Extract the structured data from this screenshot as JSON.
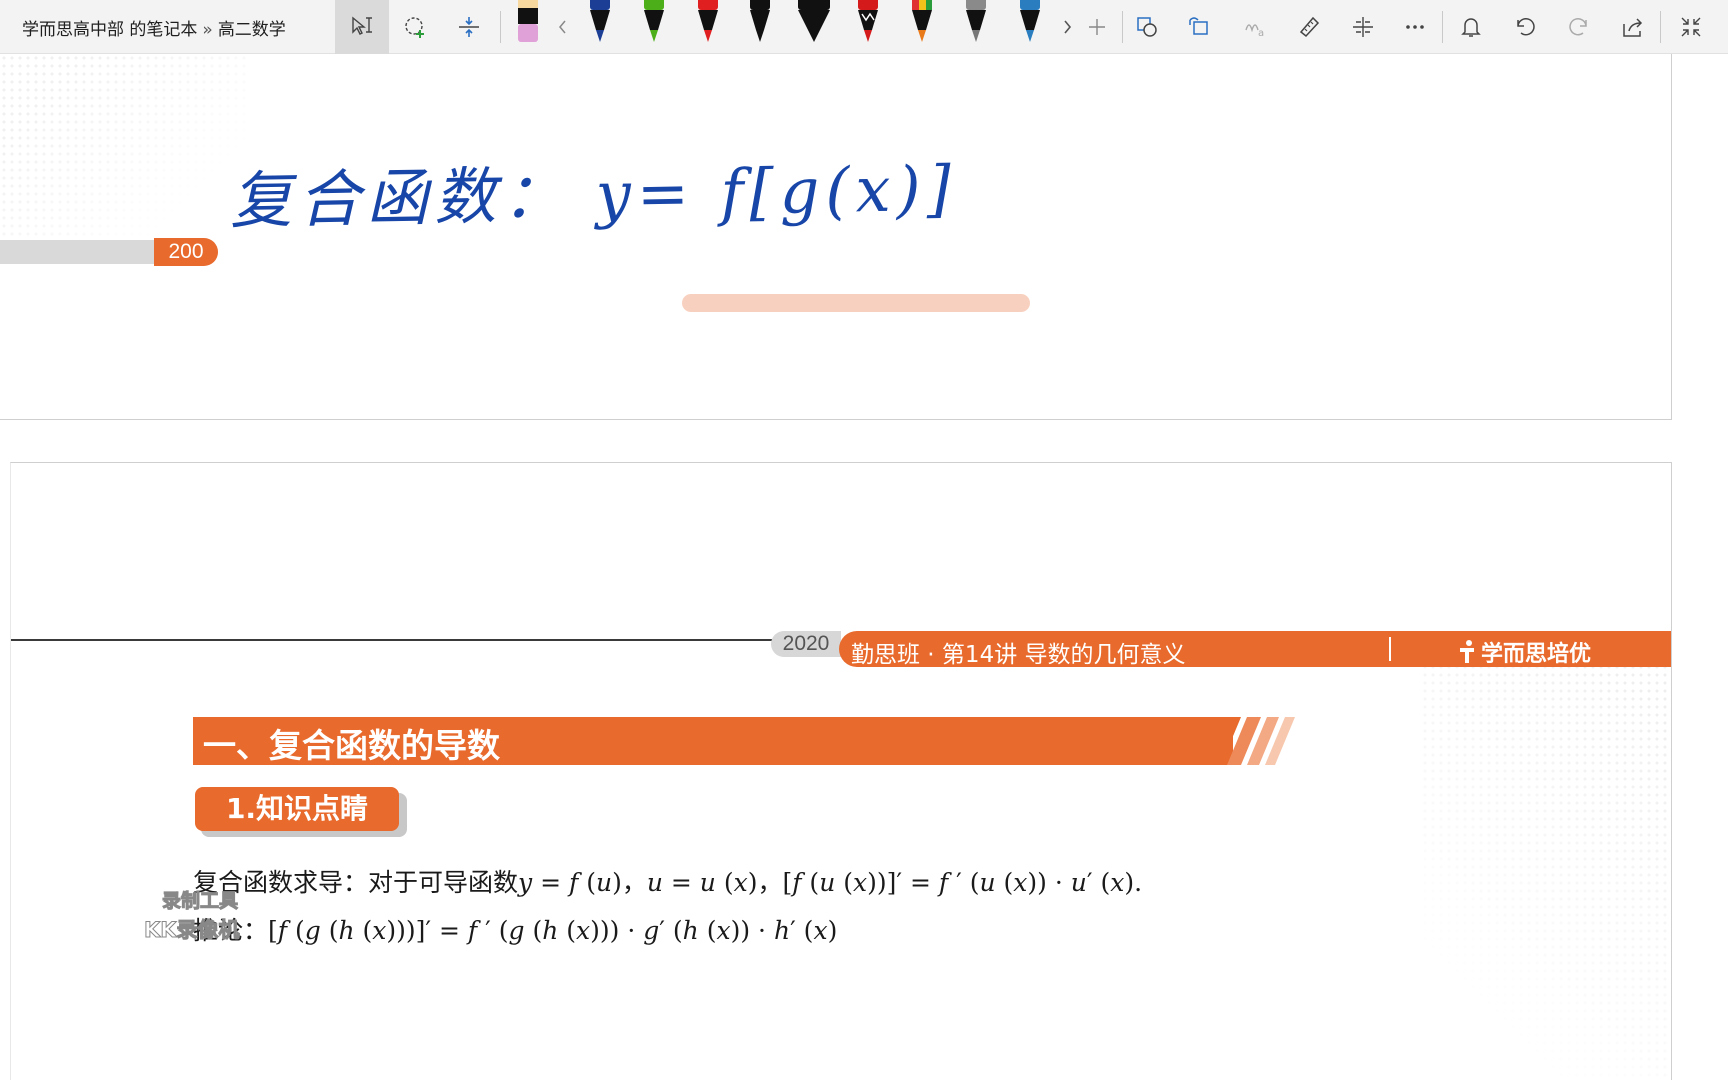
{
  "toolbar": {
    "breadcrumb_notebook": "学而思高中部 的笔记本",
    "breadcrumb_separator": "»",
    "breadcrumb_section": "高二数学",
    "tools": [
      {
        "name": "select-text-tool",
        "icon": "cursor-text-icon"
      },
      {
        "name": "lasso-tool",
        "icon": "lasso-plus-icon"
      },
      {
        "name": "add-space-tool",
        "icon": "insert-space-icon"
      },
      {
        "name": "eraser-tool",
        "icon": "eraser-icon"
      }
    ],
    "pens": [
      {
        "color": "#1c3f95",
        "label": "dark-blue"
      },
      {
        "color": "#4caf1a",
        "label": "green"
      },
      {
        "color": "#e02020",
        "label": "red"
      },
      {
        "color": "#111111",
        "label": "black"
      },
      {
        "color": "#111111",
        "label": "black-wide"
      },
      {
        "color": "#d41a1a",
        "label": "red-galaxy"
      },
      {
        "color": "#e87a1a",
        "label": "rainbow"
      },
      {
        "color": "#777777",
        "label": "gray"
      },
      {
        "color": "#2a7dbf",
        "label": "ocean"
      }
    ],
    "right_tools": [
      "shapes-icon",
      "ink-to-shape-icon",
      "ink-to-text-icon",
      "ruler-icon",
      "ink-replay-icon",
      "more-icon",
      "bell-icon",
      "undo-icon",
      "redo-icon",
      "share-icon",
      "collapse-icon"
    ]
  },
  "page1": {
    "page_number": "200",
    "handwriting": "复合函数： y= f[g(x)]",
    "ink_color": "#1846a8",
    "highlight_color": "#f7cbb8"
  },
  "page2": {
    "year": "2020",
    "course_title": "勤思班 · 第14讲 导数的几何意义",
    "brand": "学而思培优",
    "section_title": "一、复合函数的导数",
    "subsection_title": "1.知识点睛",
    "formula1_prefix": "复合函数求导：对于可导函数",
    "formula2_prefix": "推论：",
    "accent_color": "#e86a2c"
  },
  "watermark": {
    "line1": "录制工具",
    "line2": "KK录像机"
  }
}
